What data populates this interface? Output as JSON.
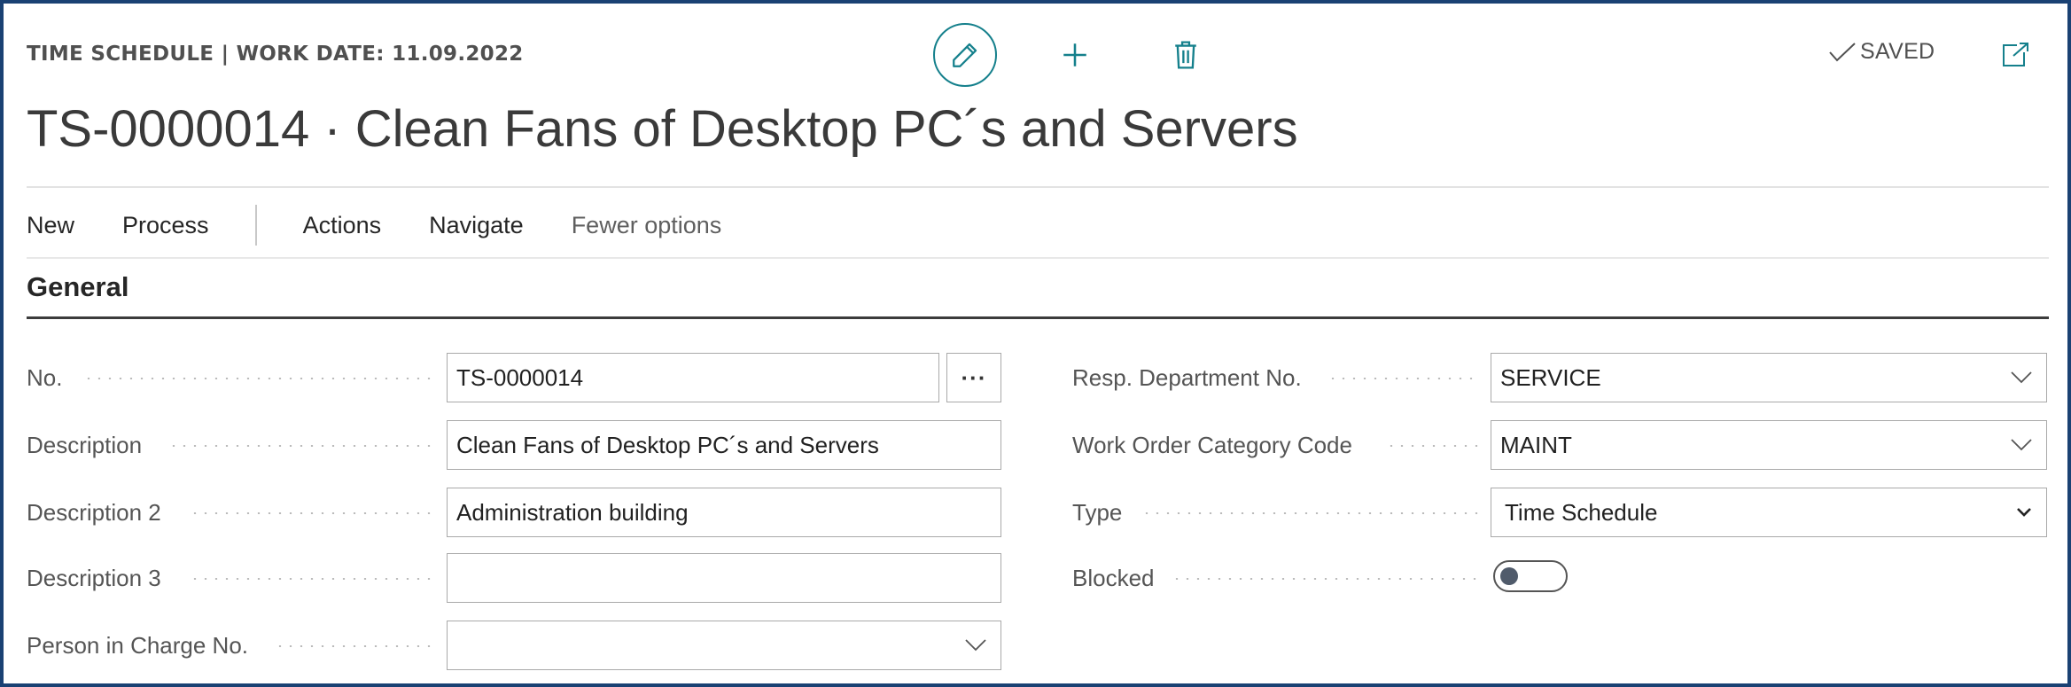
{
  "header": {
    "caption": "TIME SCHEDULE | WORK DATE: 11.09.2022",
    "title": "TS-0000014 · Clean Fans of Desktop PC´s and Servers",
    "saved_label": "SAVED",
    "icons": [
      "edit-icon",
      "add-icon",
      "delete-icon",
      "checkmark-icon",
      "open-new-window-icon"
    ]
  },
  "actions": {
    "new": "New",
    "process": "Process",
    "actions": "Actions",
    "navigate": "Navigate",
    "fewer_options": "Fewer options"
  },
  "section": {
    "title": "General"
  },
  "fields": {
    "no": {
      "label": "No.",
      "value": "TS-0000014",
      "assist": "···"
    },
    "description": {
      "label": "Description",
      "value": "Clean Fans of Desktop PC´s and Servers"
    },
    "description2": {
      "label": "Description 2",
      "value": "Administration building"
    },
    "description3": {
      "label": "Description 3",
      "value": ""
    },
    "person_in_charge": {
      "label": "Person in Charge No.",
      "value": ""
    },
    "resp_department": {
      "label": "Resp. Department No.",
      "value": "SERVICE"
    },
    "work_order_category": {
      "label": "Work Order Category Code",
      "value": "MAINT"
    },
    "type": {
      "label": "Type",
      "value": "Time Schedule"
    },
    "blocked": {
      "label": "Blocked",
      "value": false
    }
  },
  "colors": {
    "accent": "#15808c",
    "frame_border": "#1a4173",
    "section_rule": "#3c3c3c"
  }
}
